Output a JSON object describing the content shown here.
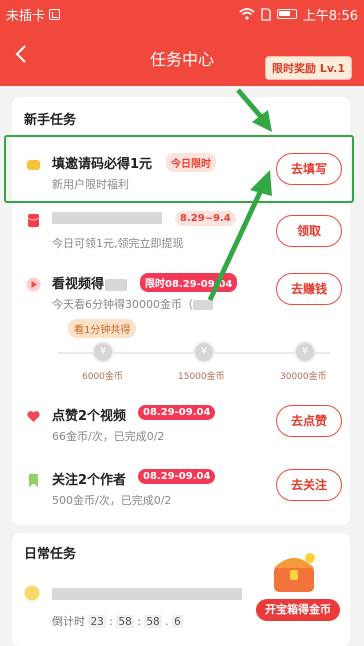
{
  "status_bar": {
    "carrier": "未插卡",
    "time": "上午8:56"
  },
  "header": {
    "back_icon": "chevron-left-icon",
    "title": "任务中心",
    "reward_badge": "限时奖励 Lv.1"
  },
  "newbie": {
    "title": "新手任务",
    "tasks": [
      {
        "name": "填邀请码必得1元",
        "tag": "今日限时",
        "desc": "新用户限时福利",
        "button": "去填写",
        "icon": "coin-stack-icon"
      },
      {
        "name": "",
        "tag": "8.29~9.4",
        "desc": "今日可领1元,领完立即提现",
        "button": "领取",
        "icon": "red-envelope-icon"
      },
      {
        "name": "看视频得",
        "tag": "限时08.29-09.04",
        "desc": "今天看6分钟得30000金币（",
        "button": "去赚钱",
        "icon": "play-icon"
      },
      {
        "name": "点赞2个视频",
        "tag": "08.29-09.04",
        "desc": "66金币/次，已完成0/2",
        "button": "去点赞",
        "icon": "heart-icon"
      },
      {
        "name": "关注2个作者",
        "tag": "08.29-09.04",
        "desc": "500金币/次，已完成0/2",
        "button": "去关注",
        "icon": "bookmark-icon"
      }
    ],
    "progress_chip": "看1分钟共得",
    "milestones": [
      {
        "label": "6000金币"
      },
      {
        "label": "15000金币"
      },
      {
        "label": "30000金币"
      }
    ]
  },
  "daily": {
    "title": "日常任务",
    "countdown_label": "倒计时",
    "countdown": [
      "23",
      "58",
      "58",
      "6"
    ]
  },
  "treasure": {
    "label": "开宝箱得金币"
  },
  "colors": {
    "brand_red": "#f0483c",
    "annotation_green": "#33a744"
  }
}
